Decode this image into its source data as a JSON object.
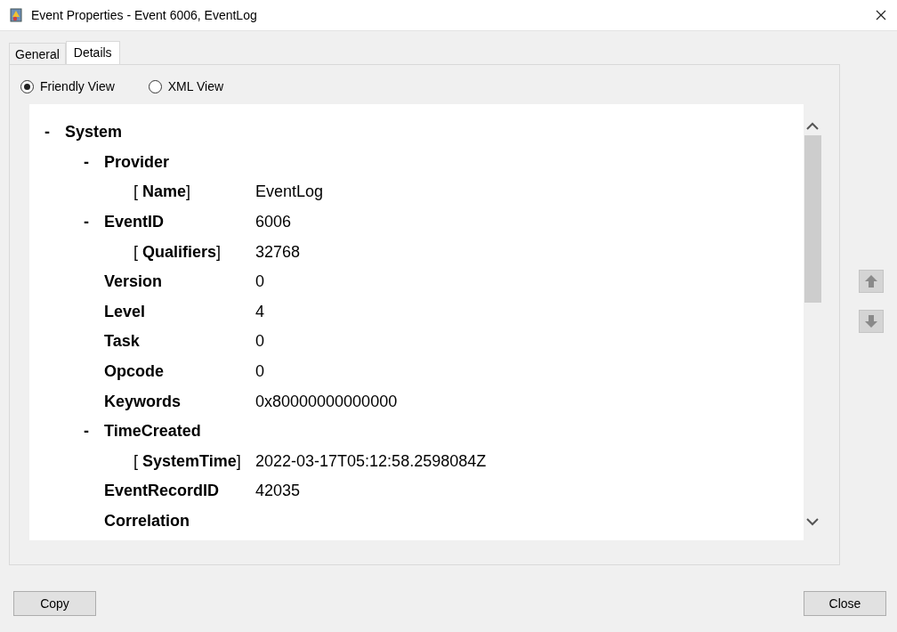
{
  "window": {
    "title": "Event Properties - Event 6006, EventLog"
  },
  "tabs": [
    {
      "label": "General",
      "selected": false
    },
    {
      "label": "Details",
      "selected": true
    }
  ],
  "view_options": [
    {
      "label": "Friendly View",
      "selected": true
    },
    {
      "label": "XML View",
      "selected": false
    }
  ],
  "tree": [
    {
      "kind": "element",
      "toggle": "-",
      "label": "System",
      "children": [
        {
          "kind": "element",
          "toggle": "-",
          "label": "Provider",
          "children": [
            {
              "kind": "attribute",
              "label": "[ **Name**]",
              "value": "EventLog"
            }
          ]
        },
        {
          "kind": "element",
          "toggle": "-",
          "label": "EventID",
          "value": "6006",
          "children": [
            {
              "kind": "attribute",
              "label": "[ **Qualifiers**]",
              "value": "32768"
            }
          ]
        },
        {
          "kind": "element",
          "label": "Version",
          "value": "0"
        },
        {
          "kind": "element",
          "label": "Level",
          "value": "4"
        },
        {
          "kind": "element",
          "label": "Task",
          "value": "0"
        },
        {
          "kind": "element",
          "label": "Opcode",
          "value": "0"
        },
        {
          "kind": "element",
          "label": "Keywords",
          "value": "0x80000000000000"
        },
        {
          "kind": "element",
          "toggle": "-",
          "label": "TimeCreated",
          "children": [
            {
              "kind": "attribute",
              "label": "[ **SystemTime**]",
              "value": "2022-03-17T05:12:58.2598084Z"
            }
          ]
        },
        {
          "kind": "element",
          "label": "EventRecordID",
          "value": "42035"
        },
        {
          "kind": "element",
          "label": "Correlation"
        }
      ]
    }
  ],
  "buttons": [
    {
      "label": "Copy"
    },
    {
      "label": "Close"
    }
  ]
}
